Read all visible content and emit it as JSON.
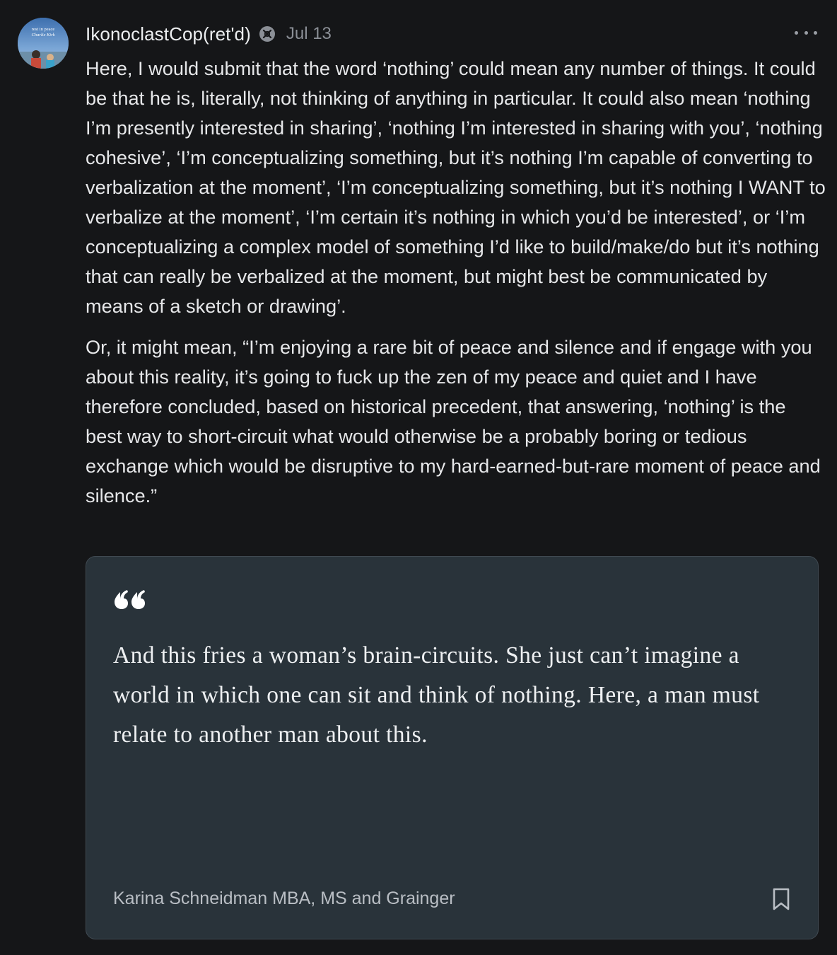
{
  "post": {
    "author": "IkonoclastCop(ret'd)",
    "date": "Jul 13",
    "avatar_caption_line1": "rest in peace",
    "avatar_caption_line2": "Charlie Kirk",
    "paragraphs": [
      "Here, I would submit that the word ‘nothing’ could mean any number of things. It could be that he is, literally, not thinking of anything in particular. It could also mean ‘nothing I’m presently interested in sharing’, ‘nothing I’m interested in sharing with you’, ‘nothing cohesive’, ‘I’m conceptualizing something, but it’s nothing I’m capable of converting to verbalization at the moment’, ‘I’m conceptualizing something, but it’s nothing I WANT to verbalize at the moment’, ‘I’m certain it’s nothing in which you’d be interested’, or ‘I’m conceptualizing a complex model of something I’d like to build/make/do but it’s nothing that can really be verbalized at the moment, but might best be communicated by means of a sketch or drawing’.",
      "Or, it might mean, “I’m enjoying a rare bit of peace and silence and if engage with you about this reality, it’s going to fuck up the zen of my peace and quiet and I have therefore concluded, based on historical precedent, that answering, ‘nothing’ is the best way to short-circuit what would otherwise be a probably boring or tedious exchange which would be disruptive to my hard-earned-but-rare moment of peace and silence.”"
    ]
  },
  "quote": {
    "text": "And this fries a woman’s brain-circuits. She just can’t imagine a world in which one can sit and think of nothing. Here, a man must relate to another man about this.",
    "attribution": "Karina Schneidman MBA, MS and Grainger"
  },
  "icons": {
    "badge": "subscriber-badge-icon",
    "more": "more-options-icon",
    "quote": "quote-mark-icon",
    "bookmark": "bookmark-icon"
  },
  "colors": {
    "background": "#151618",
    "card_background": "#29333a",
    "card_border": "#404a52",
    "text": "#e6e7e9",
    "muted": "#8b8f96"
  }
}
